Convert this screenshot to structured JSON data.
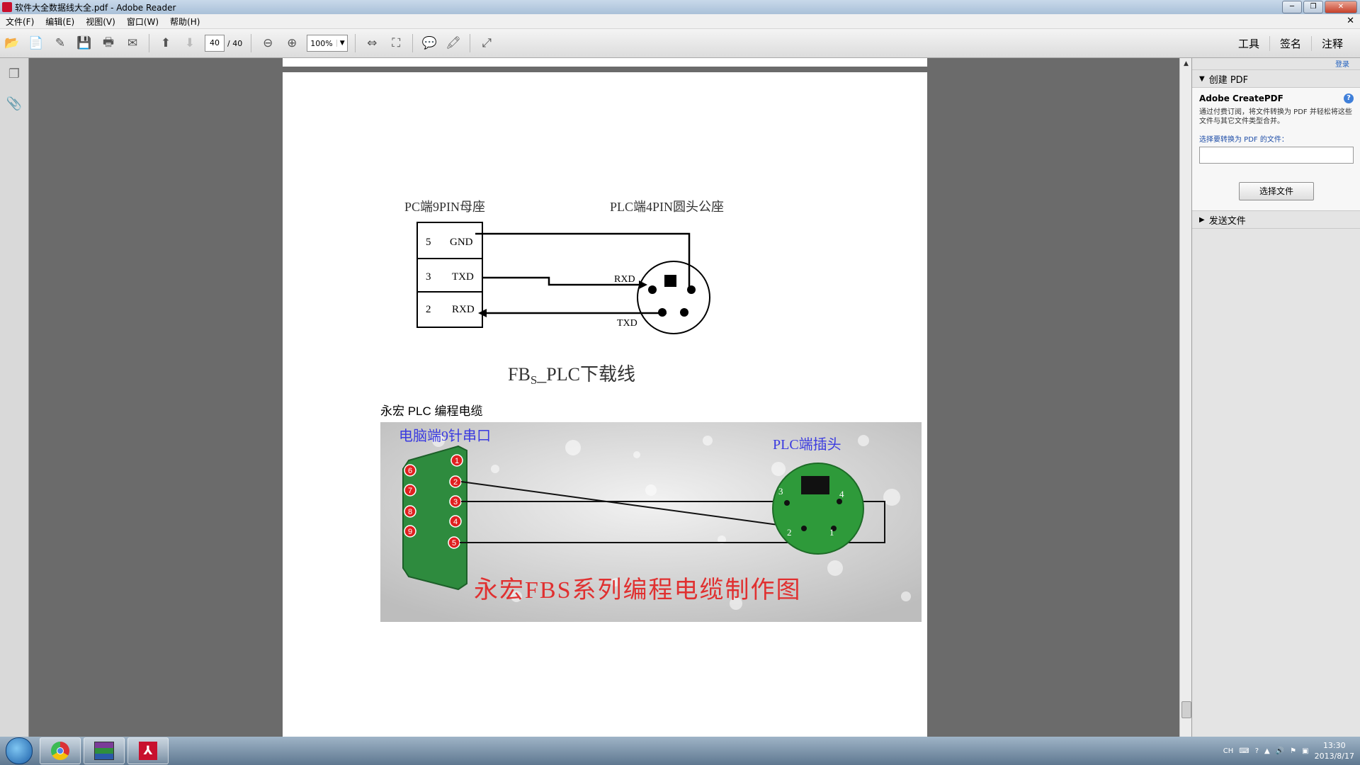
{
  "window": {
    "title": "软件大全数据线大全.pdf - Adobe Reader",
    "controls": [
      "─",
      "❐",
      "✕"
    ]
  },
  "menu": {
    "items": [
      "文件(F)",
      "编辑(E)",
      "视图(V)",
      "窗口(W)",
      "帮助(H)"
    ],
    "close": "✕"
  },
  "toolbar": {
    "page_current": "40",
    "page_total": "/ 40",
    "zoom": "100%",
    "right_links": [
      "工具",
      "签名",
      "注释"
    ]
  },
  "document": {
    "diagram1": {
      "left_header": "PC端9PIN母座",
      "right_header": "PLC端4PIN圆头公座",
      "rows": [
        {
          "pin": "5",
          "signal": "GND"
        },
        {
          "pin": "3",
          "signal": "TXD"
        },
        {
          "pin": "2",
          "signal": "RXD"
        }
      ],
      "plc_rxd": "RXD",
      "plc_txd": "TXD",
      "caption_main": "FB",
      "caption_sub": "S",
      "caption_rest": "_PLC下载线"
    },
    "section_label": "永宏 PLC 编程电缆",
    "photo": {
      "left_label": "电脑端9针串口",
      "right_label": "PLC端插头",
      "db9_pins_right": [
        "1",
        "2",
        "3",
        "4",
        "5"
      ],
      "db9_pins_left": [
        "6",
        "7",
        "8",
        "9"
      ],
      "plc_pins": [
        "3",
        "4",
        "2",
        "1"
      ],
      "bottom_title": "永宏FBS系列编程电缆制作图"
    }
  },
  "right_pane": {
    "login": "登录",
    "create_pdf_header": "创建 PDF",
    "product": "Adobe CreatePDF",
    "description": "通过付费订阅，将文件转换为 PDF 并轻松将这些文件与其它文件类型合并。",
    "file_label": "选择要转换为 PDF 的文件：",
    "choose_button": "选择文件",
    "send_files_header": "发送文件"
  },
  "taskbar": {
    "lang": "CH",
    "time": "13:30",
    "date": "2013/8/17"
  }
}
